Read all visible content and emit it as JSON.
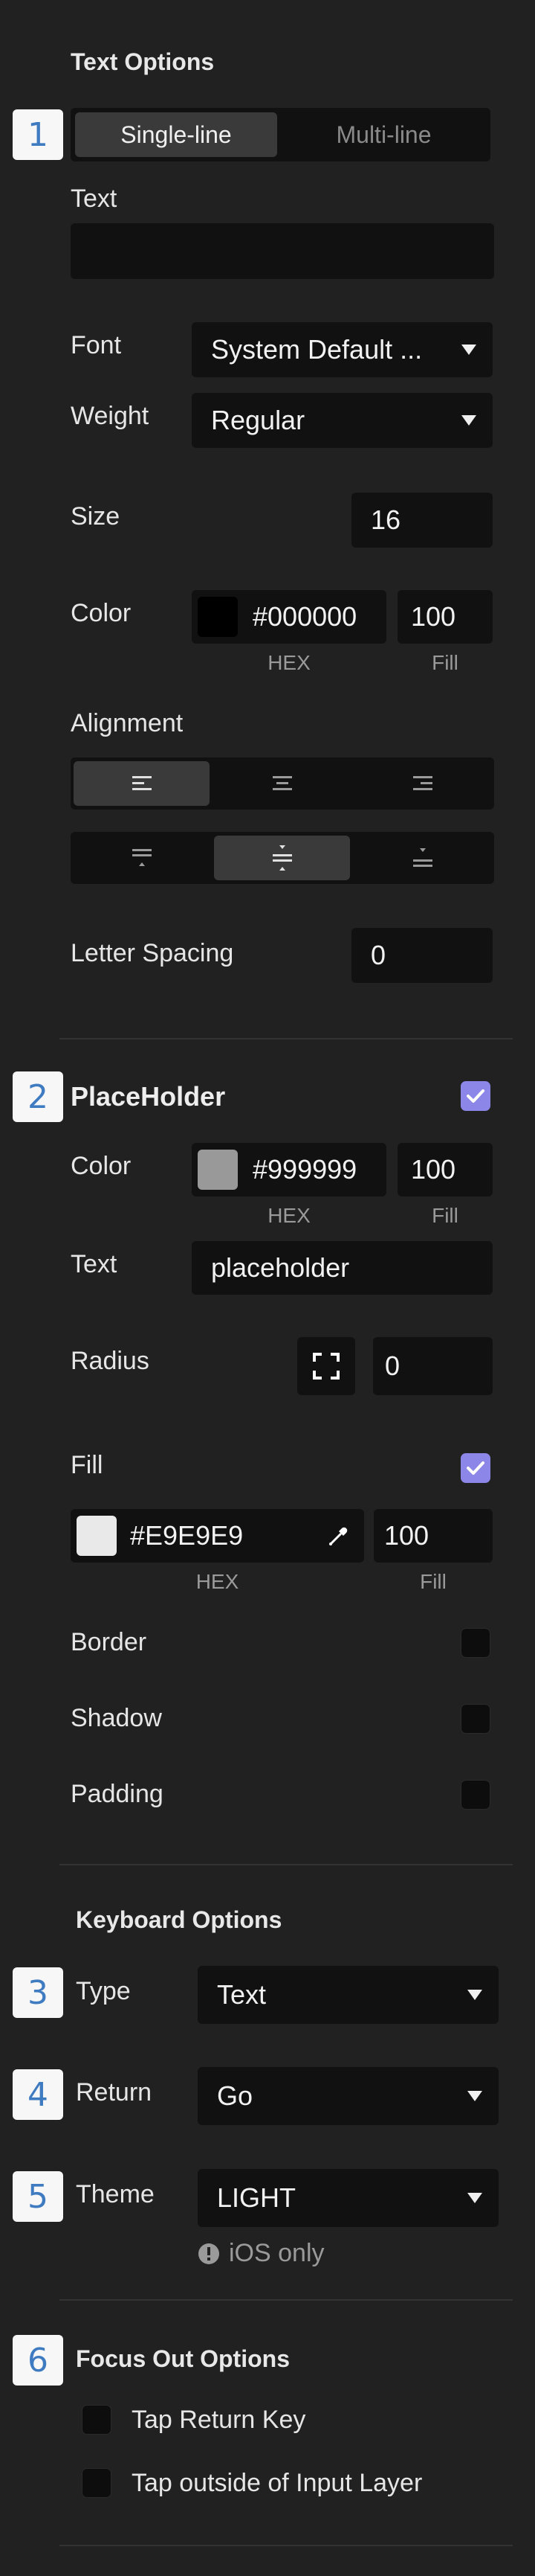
{
  "text_options": {
    "title": "Text Options",
    "badge": "1",
    "mode_tabs": [
      "Single-line",
      "Multi-line"
    ],
    "text_label": "Text",
    "text_value": "",
    "font_label": "Font",
    "font_value": "System Default ...",
    "weight_label": "Weight",
    "weight_value": "Regular",
    "size_label": "Size",
    "size_value": "16",
    "color_label": "Color",
    "color_hex": "#000000",
    "color_fill": "100",
    "hex_caption": "HEX",
    "fill_caption": "Fill",
    "alignment_label": "Alignment",
    "horizontal_alignment_selected": "left",
    "vertical_alignment_selected": "middle",
    "letter_spacing_label": "Letter Spacing",
    "letter_spacing_value": "0"
  },
  "placeholder": {
    "badge": "2",
    "title": "PlaceHolder",
    "enabled": true,
    "color_label": "Color",
    "color_hex": "#999999",
    "color_fill": "100",
    "hex_caption": "HEX",
    "fill_caption": "Fill",
    "text_label": "Text",
    "text_value": "placeholder",
    "radius_label": "Radius",
    "radius_value": "0",
    "fill_label": "Fill",
    "fill_enabled": true,
    "fill_hex": "#E9E9E9",
    "fill_fill": "100",
    "fill_hex_caption": "HEX",
    "fill_fill_caption": "Fill",
    "border_label": "Border",
    "border_enabled": false,
    "shadow_label": "Shadow",
    "shadow_enabled": false,
    "padding_label": "Padding",
    "padding_enabled": false
  },
  "keyboard": {
    "title": "Keyboard Options",
    "type_badge": "3",
    "type_label": "Type",
    "type_value": "Text",
    "return_badge": "4",
    "return_label": "Return",
    "return_value": "Go",
    "theme_badge": "5",
    "theme_label": "Theme",
    "theme_value": "LIGHT",
    "ios_note": "iOS only"
  },
  "focus_out": {
    "badge": "6",
    "title": "Focus Out Options",
    "option1": "Tap Return Key",
    "option2": "Tap outside of Input Layer"
  },
  "colors": {
    "background": "#212121",
    "field": "#111111",
    "accent": "#8c86e8",
    "badge_text": "#3f7bc0"
  }
}
